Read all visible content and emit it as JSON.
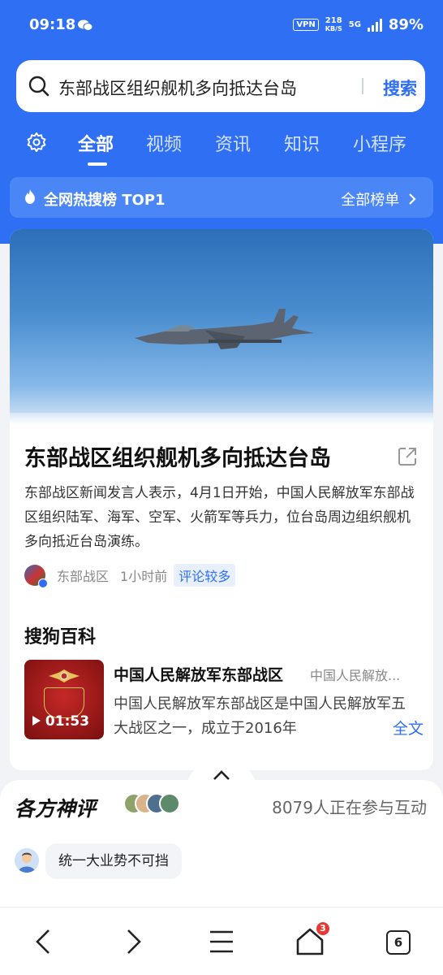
{
  "status_bar": {
    "time": "09:18",
    "vpn": "VPN",
    "net_speed": "218",
    "net_unit": "KB/S",
    "network": "5G",
    "battery": "89%"
  },
  "search": {
    "query": "东部战区组织舰机多向抵达台岛",
    "button": "搜索"
  },
  "tabs": [
    {
      "label": "全部",
      "active": true
    },
    {
      "label": "视频"
    },
    {
      "label": "资讯"
    },
    {
      "label": "知识"
    },
    {
      "label": "小程序"
    }
  ],
  "hot_banner": {
    "label": "全网热搜榜  TOP1",
    "more": "全部榜单"
  },
  "news_card": {
    "title": "东部战区组织舰机多向抵达台岛",
    "description": "东部战区新闻发言人表示，4月1日开始，中国人民解放军东部战区组织陆军、海军、空军、火箭军等兵力，位台岛周边组织舰机多向抵近台岛演练。",
    "source": "东部战区",
    "time_ago": "1小时前",
    "badge": "评论较多"
  },
  "baike": {
    "heading": "搜狗百科",
    "video_duration": "01:53",
    "title": "中国人民解放军东部战区",
    "subtitle": "中国人民解放...",
    "description": "中国人民解放军东部战区是中国人民解放军五大战区之一，成立于2016年",
    "full_text": "全文"
  },
  "comments": {
    "heading": "各方神评",
    "participants": "8079人正在参与互动",
    "top_comment": "统一大业势不可挡"
  },
  "bottom_nav": {
    "icons": [
      "back-icon",
      "forward-icon",
      "menu-icon",
      "home-icon",
      "tabs-icon"
    ],
    "home_badge": "3",
    "tab_count": "6"
  },
  "colors": {
    "brand_blue": "#2f6ff3",
    "badge_red": "#e53935"
  }
}
